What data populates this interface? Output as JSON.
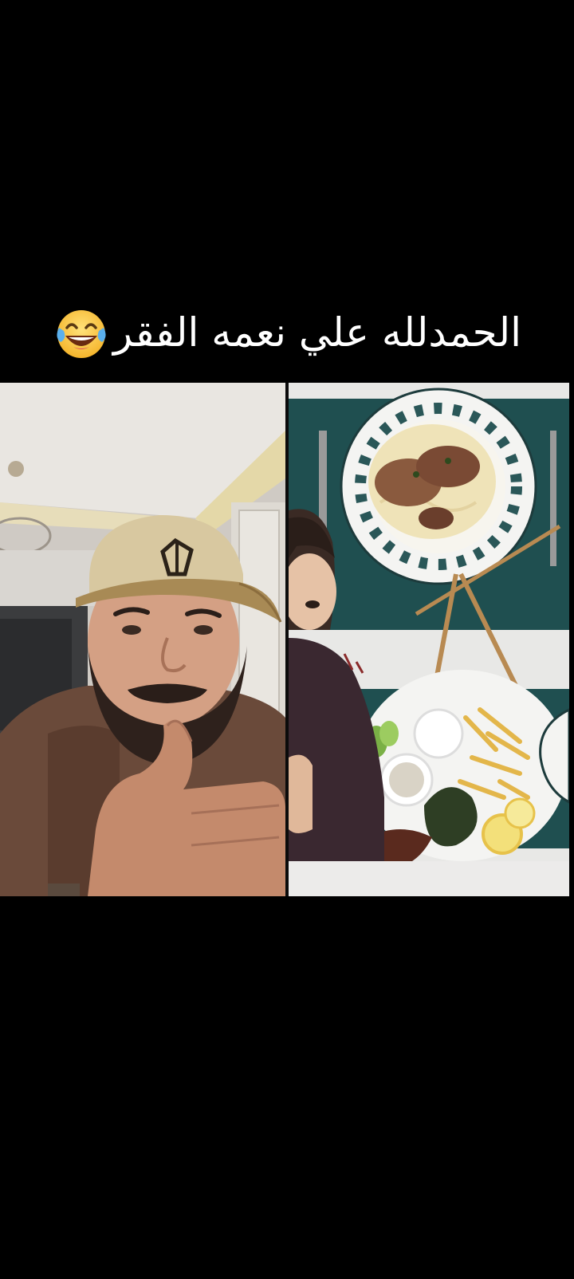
{
  "caption": {
    "text": "الحمدلله علي نعمه الفقر",
    "emoji": "face-with-tears-of-joy"
  },
  "video": {
    "left_panel": {
      "subject": "man-in-cap-thumbs-up"
    },
    "right_panel": {
      "subject": "food-plates-with-person-peeking"
    }
  },
  "colors": {
    "background": "#000000",
    "caption_text": "#ffffff",
    "cap": "#d8c8a0",
    "cap_brim": "#a88a55",
    "shirt": "#6a4a3a",
    "placemat": "#1f4f50"
  }
}
